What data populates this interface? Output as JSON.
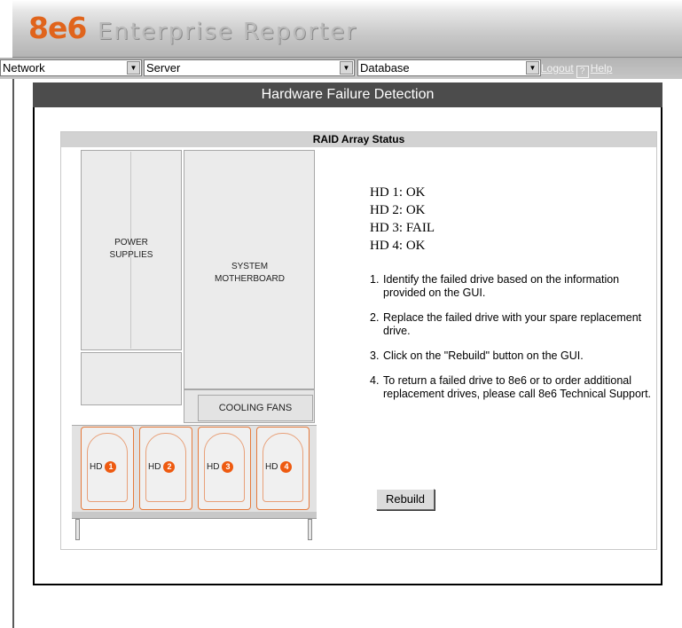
{
  "app": {
    "logo": "8e6",
    "title": "Enterprise Reporter"
  },
  "nav": {
    "network": "Network",
    "server": "Server",
    "database": "Database",
    "logout": "Logout",
    "help_box": "?",
    "help": "Help"
  },
  "page": {
    "title": "Hardware Failure Detection"
  },
  "raid": {
    "header": "RAID Array Status",
    "power_label": "POWER\nSUPPLIES",
    "motherboard_label": "SYSTEM\nMOTHERBOARD",
    "fans_label": "COOLING FANS",
    "drives": [
      {
        "label": "HD",
        "num": "1"
      },
      {
        "label": "HD",
        "num": "2"
      },
      {
        "label": "HD",
        "num": "3"
      },
      {
        "label": "HD",
        "num": "4"
      }
    ],
    "status": [
      "HD 1: OK",
      "HD 2: OK",
      "HD 3: FAIL",
      "HD 4: OK"
    ],
    "steps": [
      {
        "num": "1.",
        "text": "Identify the failed drive based on the information provided on the GUI."
      },
      {
        "num": "2.",
        "text": "Replace the failed drive with your spare replacement drive."
      },
      {
        "num": "3.",
        "text": "Click on the \"Rebuild\" button on the GUI."
      },
      {
        "num": "4.",
        "text": "To return a failed drive to 8e6 or to order additional replacement drives, please call 8e6 Technical Support."
      }
    ],
    "rebuild_label": "Rebuild"
  },
  "colors": {
    "accent": "#e0641c",
    "drive_badge": "#ee5a10",
    "title_bar": "#4c4c4c"
  }
}
